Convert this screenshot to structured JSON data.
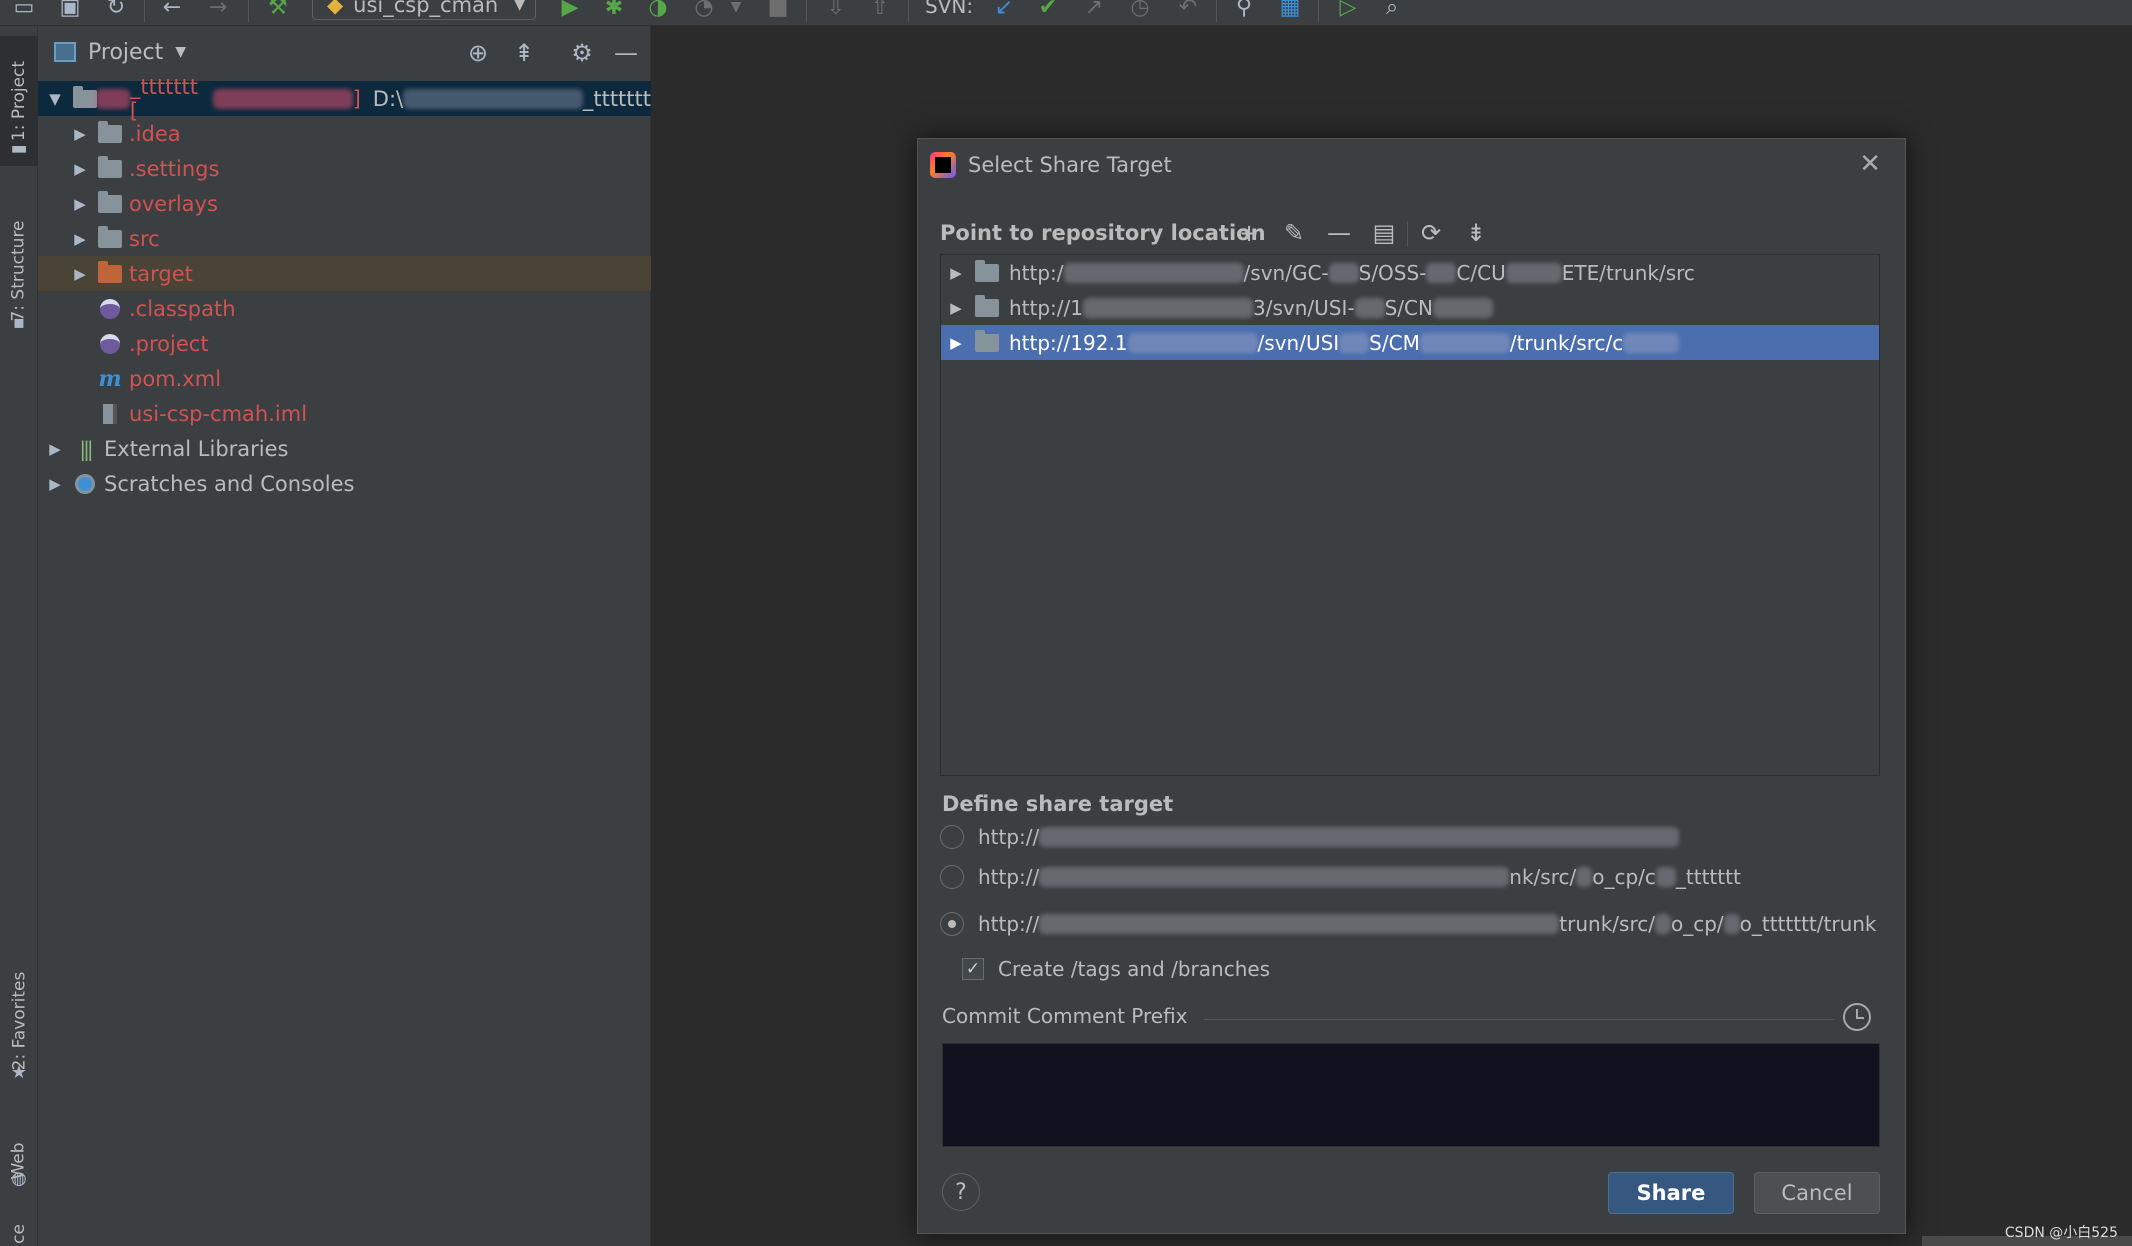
{
  "toolbar": {
    "run_config": "usi_csp_cman",
    "svn_label": "SVN:",
    "icons": [
      "open-icon",
      "save-icon",
      "sync-icon",
      "back-icon",
      "forward-icon",
      "build-icon",
      "run-icon",
      "debug-icon",
      "coverage-icon",
      "profile-icon",
      "stop-icon",
      "svn-update-icon",
      "svn-commit-icon",
      "svn-compare-icon",
      "svn-history-icon",
      "svn-revert-icon",
      "settings-wrench-icon",
      "project-structure-icon",
      "run-anything-icon",
      "search-icon"
    ]
  },
  "left_strip": {
    "tabs": [
      {
        "label": "1: Project",
        "icon": "project-icon"
      },
      {
        "label": "7: Structure",
        "icon": "structure-icon"
      },
      {
        "label": "2: Favorites",
        "icon": "star-icon"
      },
      {
        "label": "Web",
        "icon": "globe-icon"
      },
      {
        "label": "ce"
      }
    ]
  },
  "project_panel": {
    "title": "Project",
    "root": {
      "name": "_ttttttt [",
      "name_close": "]",
      "path_prefix": "D:\\",
      "path_suffix": "_ttttttt"
    },
    "items": [
      {
        "label": ".idea",
        "kind": "folder",
        "color": "red"
      },
      {
        "label": ".settings",
        "kind": "folder",
        "color": "red"
      },
      {
        "label": "overlays",
        "kind": "folder",
        "color": "red"
      },
      {
        "label": "src",
        "kind": "folder",
        "color": "red"
      },
      {
        "label": "target",
        "kind": "folder-orange",
        "color": "red"
      },
      {
        "label": ".classpath",
        "kind": "eclipse-file",
        "color": "red"
      },
      {
        "label": ".project",
        "kind": "eclipse-file",
        "color": "red"
      },
      {
        "label": "pom.xml",
        "kind": "maven-file",
        "color": "red"
      },
      {
        "label": "usi-csp-cmah.iml",
        "kind": "iml-file",
        "color": "red"
      }
    ],
    "external_libraries": "External Libraries",
    "scratches": "Scratches and Consoles"
  },
  "dialog": {
    "title": "Select Share Target",
    "repo_label": "Point to repository location",
    "repo_actions": [
      "add-icon",
      "edit-icon",
      "remove-icon",
      "copy-icon",
      "refresh-icon",
      "collapse-icon"
    ],
    "repos": [
      {
        "a": "http:/",
        "b": "/svn/GC-",
        "c": "S/OSS-",
        "d": "C/CU",
        "e": "ETE/trunk/src",
        "selected": false
      },
      {
        "a": "http://1",
        "b": "3/svn/USI-",
        "c": "S/CN",
        "d": "",
        "e": "",
        "selected": false
      },
      {
        "a": "http://192.1",
        "b": "/svn/USI",
        "c": "S/CM",
        "d": "/trunk/src/c",
        "e": "",
        "selected": true
      }
    ],
    "define_label": "Define share target",
    "targets": [
      {
        "a": "http://",
        "b": "",
        "checked": false
      },
      {
        "a": "http://",
        "b": "nk/src/",
        "c": "o_cp/c",
        "d": "_ttttttt",
        "checked": false
      },
      {
        "a": "http://",
        "b": "trunk/src/",
        "c": "o_cp/",
        "d": "o_ttttttt/trunk",
        "checked": true
      }
    ],
    "create_tags_label": "Create /tags and /branches",
    "create_tags_checked": true,
    "commit_prefix_label": "Commit Comment Prefix",
    "commit_prefix_value": "",
    "share_label": "Share",
    "cancel_label": "Cancel",
    "help_label": "?",
    "close_label": "✕"
  },
  "watermark": "CSDN @小白525"
}
